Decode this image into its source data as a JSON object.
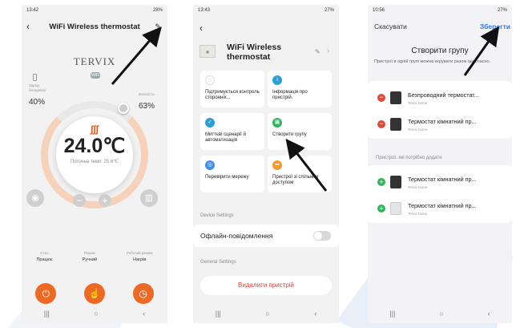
{
  "phone1": {
    "status_time": "13:42",
    "status_right": "28%",
    "title": "WiFi Wireless thermostat",
    "brand": "TERVIX",
    "wifi_badge": "WiFi",
    "battery_label": "Заряд батарейок",
    "battery_value": "40%",
    "humidity_label": "Вологість",
    "humidity_value": "63%",
    "heat_icon": "heat-waves-icon",
    "temperature": "24.0℃",
    "current_temp": "Поточна темп: 25.6℃",
    "minus": "−",
    "plus": "+",
    "modes": [
      {
        "label": "Стан",
        "value": "Працює"
      },
      {
        "label": "Режим",
        "value": "Ручний"
      },
      {
        "label": "Робочий режим",
        "value": "Нагрів"
      }
    ],
    "nav": [
      "|||",
      "○",
      "‹"
    ]
  },
  "phone2": {
    "status_time": "13:43",
    "status_right": "27%",
    "device_name": "WiFi Wireless thermostat",
    "tiles": [
      {
        "label": "Підтримується контроль сторонніх...",
        "color": "#ffffff"
      },
      {
        "label": "Інформація про пристрій.",
        "color": "#2a9fd6"
      },
      {
        "label": "Миттєві сценарії й автоматизація",
        "color": "#2a9fd6"
      },
      {
        "label": "Створити групу",
        "color": "#2fb55d"
      },
      {
        "label": "Перевірити мережу",
        "color": "#3f8ee8"
      },
      {
        "label": "Пристрої зі спільним доступом",
        "color": "#f39a2b"
      }
    ],
    "device_settings": "Device Settings",
    "offline_notif": "Офлайн-повідомлення",
    "general_settings": "General Settings",
    "delete_device": "Видалити пристрій",
    "nav": [
      "|||",
      "○",
      "‹"
    ]
  },
  "phone3": {
    "status_time": "10:56",
    "status_right": "27%",
    "cancel": "Скасувати",
    "save": "Зберегти",
    "title": "Створити групу",
    "info": "Пристрої в одній групі можна керувати разом одночасно.",
    "group_devices": [
      {
        "name": "Безпроводний термостат...",
        "sub": "Tervix home"
      },
      {
        "name": "Термостат кімнатний пр...",
        "sub": "Tervix home"
      }
    ],
    "add_section": "Пристрої, які потрібно додати",
    "add_devices": [
      {
        "name": "Термостат кімнатний пр...",
        "sub": "Tervix home"
      },
      {
        "name": "Термостат кімнатний пр...",
        "sub": "Tervix home"
      }
    ],
    "nav": [
      "|||",
      "○",
      "‹"
    ]
  },
  "colors": {
    "accent_orange": "#ee6a24",
    "save_blue": "#2f7be8",
    "delete_red": "#e4402e"
  }
}
